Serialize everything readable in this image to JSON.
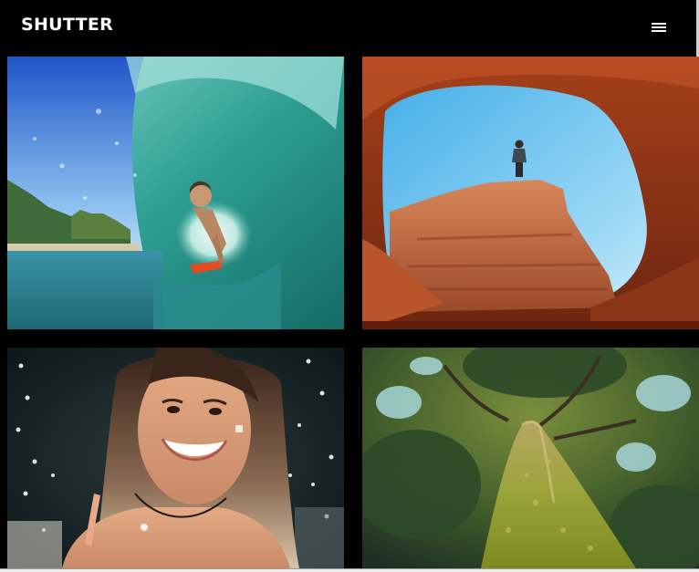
{
  "header": {
    "brand": "SHUTTER",
    "menu_icon": "hamburger-menu-icon"
  },
  "gallery": {
    "photos": [
      {
        "subject": "surfer-in-wave-barrel"
      },
      {
        "subject": "hiker-on-red-rock-arch"
      },
      {
        "subject": "smiling-woman-portrait"
      },
      {
        "subject": "mossy-tree-trunk-canopy"
      }
    ]
  },
  "colors": {
    "background": "#000000",
    "brand_text": "#ffffff"
  }
}
